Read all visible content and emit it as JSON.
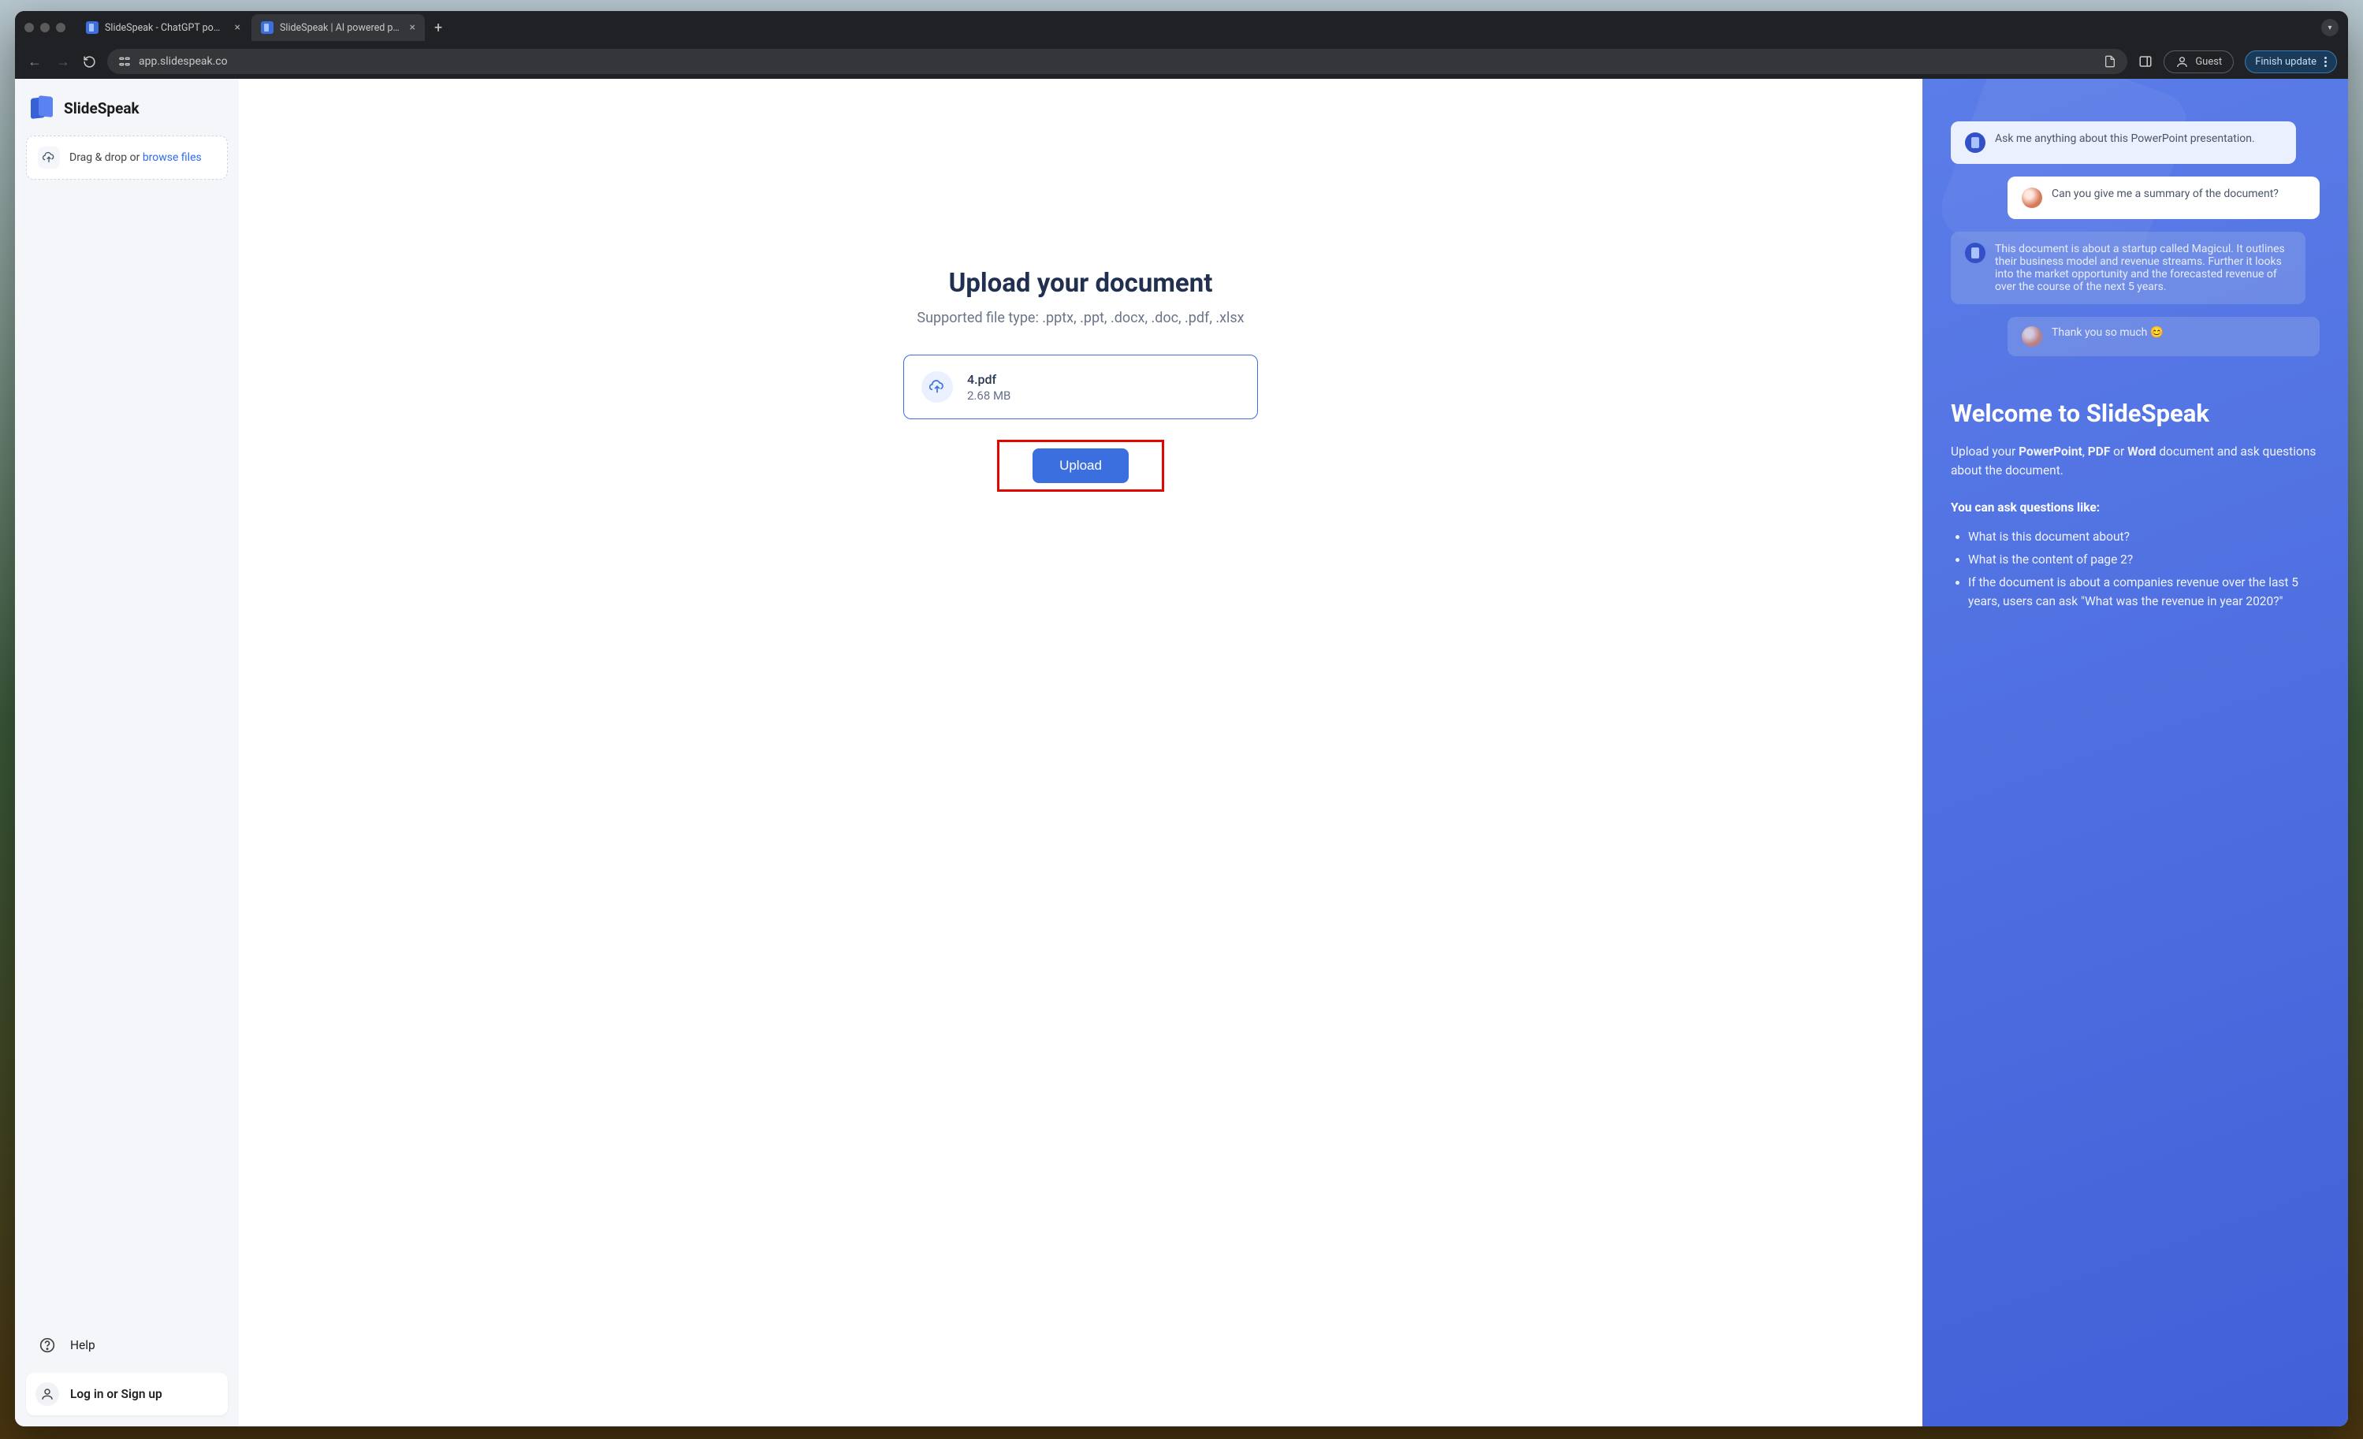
{
  "browser": {
    "tabs": [
      {
        "title": "SlideSpeak - ChatGPT powered …"
      },
      {
        "title": "SlideSpeak | AI powered pres…"
      }
    ],
    "url": "app.slidespeak.co",
    "guest_label": "Guest",
    "finish_label": "Finish update"
  },
  "sidebar": {
    "brand": "SlideSpeak",
    "drop_text": "Drag & drop or ",
    "browse_text": "browse files",
    "help": "Help",
    "login": "Log in or Sign up"
  },
  "main": {
    "heading": "Upload your document",
    "subheading": "Supported file type: .pptx, .ppt, .docx, .doc, .pdf, .xlsx",
    "file_name": "4.pdf",
    "file_size": "2.68 MB",
    "upload_label": "Upload"
  },
  "welcome": {
    "bubbles": {
      "bot1": "Ask me anything about this PowerPoint presentation.",
      "user1": "Can you give me a summary of the document?",
      "bot2": "This document is about a startup called Magicul. It outlines their business model and revenue streams. Further it looks into the market opportunity and the forecasted revenue of over the course of the next 5 years.",
      "user2": "Thank you so much 😊"
    },
    "heading": "Welcome to SlideSpeak",
    "body_pre": "Upload your ",
    "body_pp": "PowerPoint",
    "body_sep1": ", ",
    "body_pdf": "PDF",
    "body_sep2": " or ",
    "body_word": "Word",
    "body_post": " document and ask questions about the document.",
    "sub": "You can ask questions like:",
    "items": [
      "What is this document about?",
      "What is the content of page 2?",
      "If the document is about a companies revenue over the last 5 years, users can ask \"What was the revenue in year 2020?\""
    ]
  }
}
